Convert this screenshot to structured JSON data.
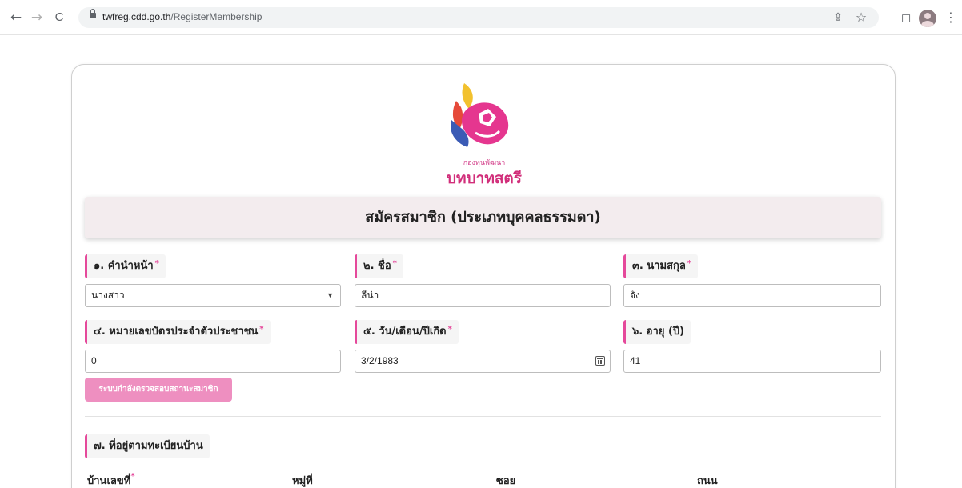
{
  "browser": {
    "url_domain": "twfreg.cdd.go.th",
    "url_path": "/RegisterMembership",
    "back_glyph": "←",
    "forward_glyph": "→",
    "reload_glyph": "C",
    "share_glyph": "⇪",
    "star_glyph": "☆",
    "sidepanel_glyph": "◻",
    "menu_glyph": "⋮"
  },
  "logo": {
    "small_text": "กองทุนพัฒนา",
    "big_text": "บทบาทสตรี",
    "colors": {
      "pink": "#e5368f",
      "red": "#d9313a",
      "yellow": "#f2c12e",
      "blue": "#3b5bb5"
    }
  },
  "page": {
    "title": "สมัครสมาชิก (ประเภทบุคคลธรรมดา)"
  },
  "form": {
    "prefix": {
      "label": "๑. คำนำหน้า",
      "required": "*",
      "value": "นางสาว",
      "caret": "▼"
    },
    "first_name": {
      "label": "๒. ชื่อ",
      "required": "*",
      "value": "ลีน่า"
    },
    "last_name": {
      "label": "๓. นามสกุล",
      "required": "*",
      "value": "จัง"
    },
    "id_card": {
      "label": "๔. หมายเลขบัตรประจำตัวประชาชน",
      "required": "*",
      "value": "0"
    },
    "birth_date": {
      "label": "๕. วัน/เดือน/ปีเกิด",
      "required": "*",
      "value": "3/2/1983"
    },
    "age": {
      "label": "๖. อายุ (ปี)",
      "value": "41"
    },
    "status_button": "ระบบกำลังตรวจสอบสถานะสมาชิก",
    "address_section": {
      "label": "๗. ที่อยู่ตามทะเบียนบ้าน",
      "house_no": "บ้านเลขที่",
      "house_no_required": "*",
      "moo": "หมู่ที่",
      "soi": "ซอย",
      "road": "ถนน"
    }
  },
  "colors": {
    "accent_pink": "#e5499b",
    "button_pink": "#ee8fc0",
    "title_bg": "#f3ecee"
  }
}
